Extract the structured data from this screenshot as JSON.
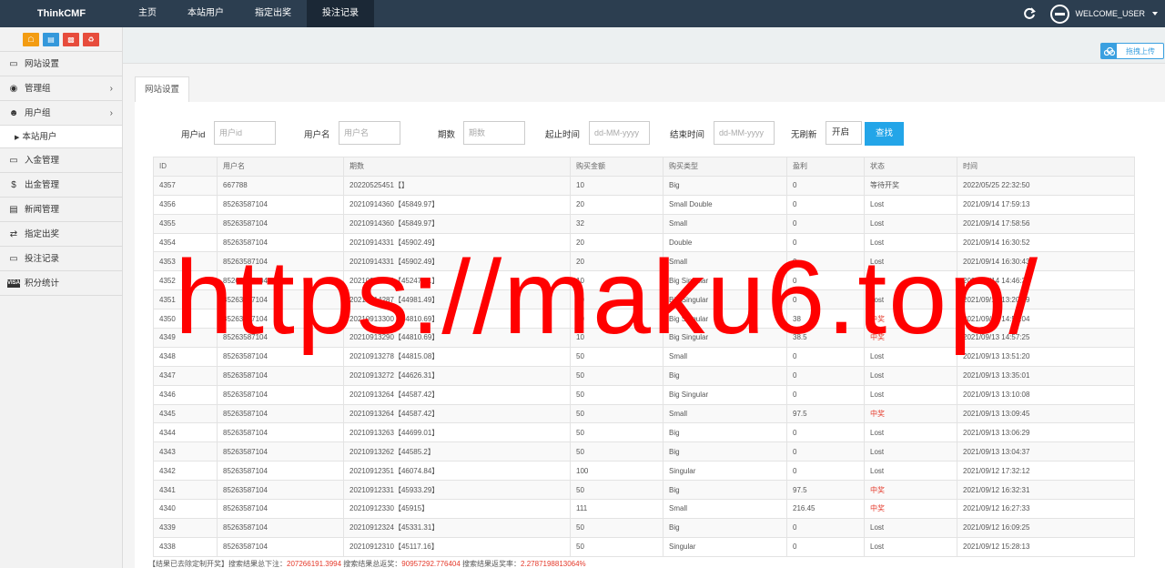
{
  "brand": "ThinkCMF",
  "nav": [
    {
      "label": "主页"
    },
    {
      "label": "本站用户"
    },
    {
      "label": "指定出奖"
    },
    {
      "label": "投注记录"
    }
  ],
  "user": {
    "welcome": "WELCOME_USER"
  },
  "sidebar": {
    "items": [
      {
        "label": "网站设置",
        "icon": "monitor-icon"
      },
      {
        "label": "管理组",
        "icon": "user-circle-icon"
      },
      {
        "label": "用户组",
        "icon": "user-icon"
      },
      {
        "label": "本站用户",
        "icon": "caret-right-icon"
      },
      {
        "label": "入金管理",
        "icon": "monitor-icon"
      },
      {
        "label": "出金管理",
        "icon": "dollar-icon"
      },
      {
        "label": "新闻管理",
        "icon": "newspaper-icon"
      },
      {
        "label": "指定出奖",
        "icon": "exchange-icon"
      },
      {
        "label": "投注记录",
        "icon": "monitor-icon"
      },
      {
        "label": "积分统计",
        "icon": "visa-icon"
      }
    ]
  },
  "upload": {
    "label": "拖拽上传"
  },
  "tab": {
    "label": "网站设置"
  },
  "search": {
    "user_id_label": "用户id",
    "user_id_placeholder": "用户id",
    "username_label": "用户名",
    "username_placeholder": "用户名",
    "period_label": "期数",
    "period_placeholder": "期数",
    "start_label": "起止时间",
    "start_placeholder": "dd-MM-yyyy",
    "end_label": "结束时间",
    "end_placeholder": "dd-MM-yyyy",
    "norefresh_label": "无刷新",
    "norefresh_value": "开启",
    "button": "查找"
  },
  "table": {
    "headers": [
      "ID",
      "用户名",
      "期数",
      "购买金额",
      "购买类型",
      "盈利",
      "状态",
      "时间"
    ],
    "rows": [
      [
        "4357",
        "667788",
        "20220525451【】",
        "10",
        "Big",
        "0",
        "等待开奖",
        "2022/05/25 22:32:50"
      ],
      [
        "4356",
        "85263587104",
        "20210914360【45849.97】",
        "20",
        "Small Double",
        "0",
        "Lost",
        "2021/09/14 17:59:13"
      ],
      [
        "4355",
        "85263587104",
        "20210914360【45849.97】",
        "32",
        "Small",
        "0",
        "Lost",
        "2021/09/14 17:58:56"
      ],
      [
        "4354",
        "85263587104",
        "20210914331【45902.49】",
        "20",
        "Double",
        "0",
        "Lost",
        "2021/09/14 16:30:52"
      ],
      [
        "4353",
        "85263587104",
        "20210914331【45902.49】",
        "20",
        "Small",
        "0",
        "Lost",
        "2021/09/14 16:30:43"
      ],
      [
        "4352",
        "85263587104",
        "20210914296【45247.21】",
        "10",
        "Big Singular",
        "0",
        "Lost",
        "2021/09/14 14:46:39"
      ],
      [
        "4351",
        "85263587104",
        "20210914287【44981.49】",
        "10",
        "Big Singular",
        "0",
        "Lost",
        "2021/09/14 13:20:59"
      ],
      [
        "4350",
        "85263587104",
        "20210913300【44810.69】",
        "10",
        "Big Singular",
        "38",
        "中奖",
        "2021/09/13 14:58:04"
      ],
      [
        "4349",
        "85263587104",
        "20210913290【44810.69】",
        "10",
        "Big Singular",
        "38.5",
        "中奖",
        "2021/09/13 14:57:25"
      ],
      [
        "4348",
        "85263587104",
        "20210913278【44815.08】",
        "50",
        "Small",
        "0",
        "Lost",
        "2021/09/13 13:51:20"
      ],
      [
        "4347",
        "85263587104",
        "20210913272【44626.31】",
        "50",
        "Big",
        "0",
        "Lost",
        "2021/09/13 13:35:01"
      ],
      [
        "4346",
        "85263587104",
        "20210913264【44587.42】",
        "50",
        "Big Singular",
        "0",
        "Lost",
        "2021/09/13 13:10:08"
      ],
      [
        "4345",
        "85263587104",
        "20210913264【44587.42】",
        "50",
        "Small",
        "97.5",
        "中奖",
        "2021/09/13 13:09:45"
      ],
      [
        "4344",
        "85263587104",
        "20210913263【44699.01】",
        "50",
        "Big",
        "0",
        "Lost",
        "2021/09/13 13:06:29"
      ],
      [
        "4343",
        "85263587104",
        "20210913262【44585.2】",
        "50",
        "Big",
        "0",
        "Lost",
        "2021/09/13 13:04:37"
      ],
      [
        "4342",
        "85263587104",
        "20210912351【46074.84】",
        "100",
        "Singular",
        "0",
        "Lost",
        "2021/09/12 17:32:12"
      ],
      [
        "4341",
        "85263587104",
        "20210912331【45933.29】",
        "50",
        "Big",
        "97.5",
        "中奖",
        "2021/09/12 16:32:31"
      ],
      [
        "4340",
        "85263587104",
        "20210912330【45915】",
        "111",
        "Small",
        "216.45",
        "中奖",
        "2021/09/12 16:27:33"
      ],
      [
        "4339",
        "85263587104",
        "20210912324【45331.31】",
        "50",
        "Big",
        "0",
        "Lost",
        "2021/09/12 16:09:25"
      ],
      [
        "4338",
        "85263587104",
        "20210912310【45117.16】",
        "50",
        "Singular",
        "0",
        "Lost",
        "2021/09/12 15:28:13"
      ]
    ]
  },
  "summary": {
    "prefix": "【结果已去除定制开奖】搜索结果总下注：",
    "total_bet": "207266191.3994",
    "mid1": " 搜索结果总返奖：",
    "total_return": "90957292.776404",
    "mid2": " 搜索结果返奖率：",
    "return_rate": "2.2787198813064%"
  },
  "watermark": "https://maku6.top/",
  "colors": {
    "navbar": "#2c3e50",
    "accent": "#23a5e8",
    "win": "#e53a2b",
    "watermark": "#ff0000"
  }
}
